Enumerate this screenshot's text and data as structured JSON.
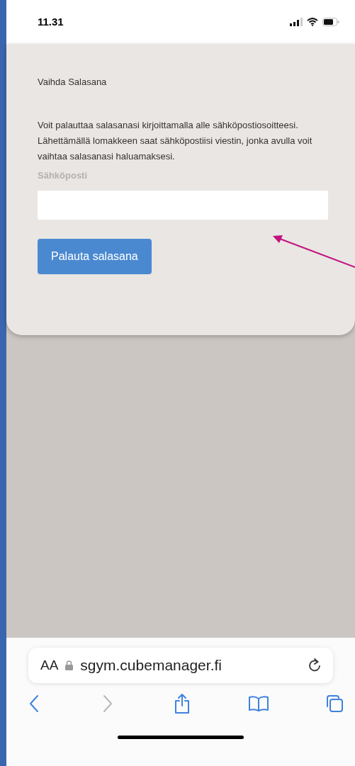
{
  "status_bar": {
    "time": "11.31"
  },
  "card": {
    "title": "Vaihda Salasana",
    "paragraphs": [
      "Voit palauttaa salasanasi kirjoittamalla alle sähköpostiosoitteesi.",
      "Lähettämällä lomakkeen saat sähköpostiisi viestin, jonka avulla voit vaihtaa salasanasi haluamaksesi."
    ],
    "field": {
      "label": "Sähköposti"
    },
    "button": "Palauta salasana"
  },
  "address_bar": {
    "text_size": "AA",
    "url": "sgym.cubemanager.fi"
  },
  "toolbar": [
    {
      "kind": "back",
      "disabled": false
    },
    {
      "kind": "forward",
      "disabled": true
    },
    {
      "kind": "share",
      "disabled": false
    },
    {
      "kind": "bookmarks",
      "disabled": false
    },
    {
      "kind": "tabs",
      "disabled": false
    }
  ]
}
